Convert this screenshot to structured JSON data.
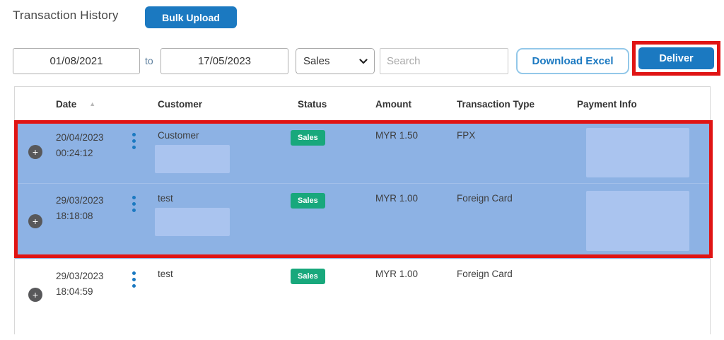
{
  "page": {
    "title": "Transaction History"
  },
  "toolbar": {
    "bulk_upload_label": "Bulk Upload",
    "date_from": "01/08/2021",
    "range_separator": "to",
    "date_to": "17/05/2023",
    "type_filter_selected": "Sales",
    "search_placeholder": "Search",
    "download_excel_label": "Download Excel",
    "deliver_label": "Deliver"
  },
  "table": {
    "headers": {
      "date": "Date",
      "customer": "Customer",
      "status": "Status",
      "amount": "Amount",
      "transaction_type": "Transaction Type",
      "payment_info": "Payment Info"
    },
    "rows": [
      {
        "date": "20/04/2023",
        "time": "00:24:12",
        "customer": "Customer",
        "status": "Sales",
        "amount": "MYR 1.50",
        "transaction_type": "FPX",
        "selected": true
      },
      {
        "date": "29/03/2023",
        "time": "18:18:08",
        "customer": "test",
        "status": "Sales",
        "amount": "MYR 1.00",
        "transaction_type": "Foreign Card",
        "selected": true
      },
      {
        "date": "29/03/2023",
        "time": "18:04:59",
        "customer": "test",
        "status": "Sales",
        "amount": "MYR 1.00",
        "transaction_type": "Foreign Card",
        "selected": false
      }
    ]
  },
  "icons": {
    "expand": "+",
    "sort_ascending": "▲"
  },
  "colors": {
    "primary_blue": "#1b79c1",
    "row_highlight_blue": "#8db2e4",
    "redaction_blue": "#aac4ef",
    "badge_green": "#18a87c",
    "annotation_red": "#e01414"
  }
}
